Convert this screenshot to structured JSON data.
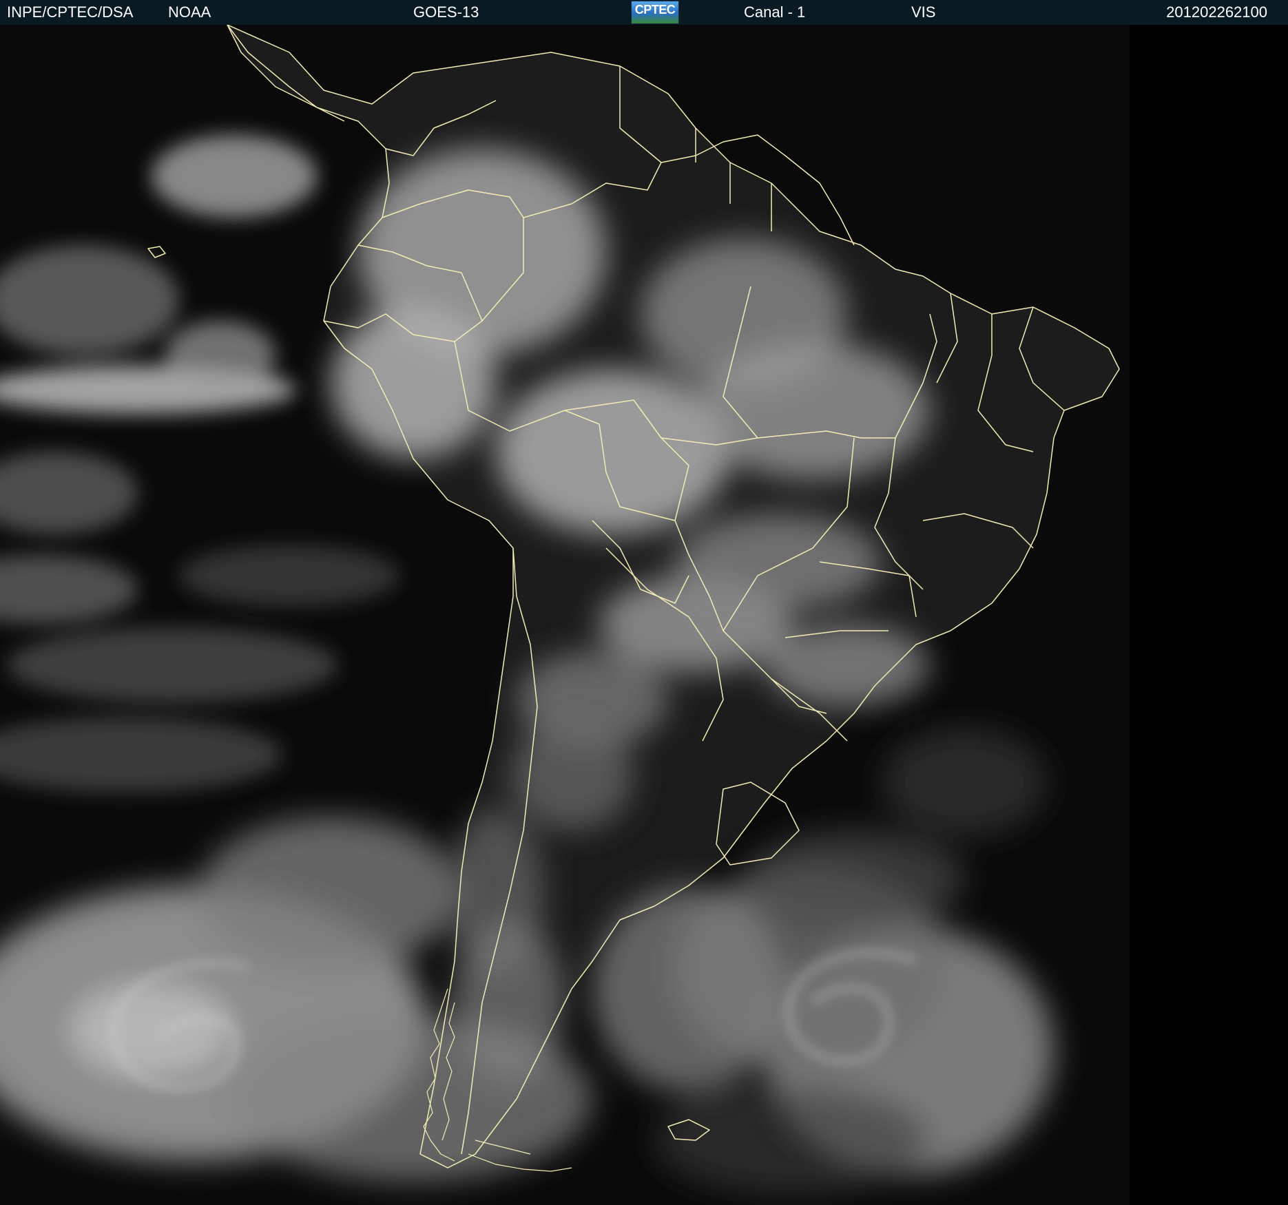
{
  "header": {
    "institution": "INPE/CPTEC/DSA",
    "agency": "NOAA",
    "satellite": "GOES-13",
    "logo_text": "CPTEC",
    "channel": "Canal - 1",
    "band": "VIS",
    "timestamp": "201202262100"
  },
  "imagery": {
    "type": "visible satellite image",
    "region": "South America",
    "colors": {
      "background": "#000000",
      "cloud": "#bfbfbf",
      "cloud_bright": "#ececec",
      "land": "#202020",
      "borders": "#f2ecb4",
      "header": "#0a1a22"
    }
  }
}
